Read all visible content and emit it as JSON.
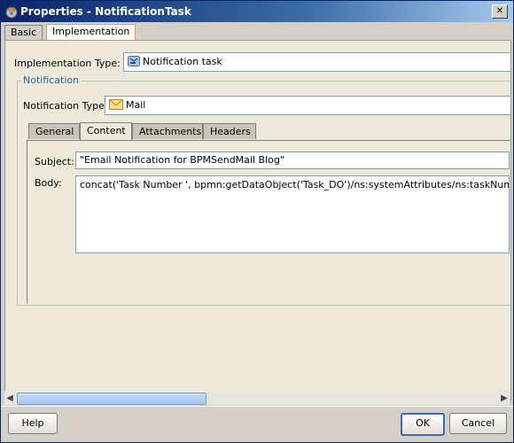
{
  "window": {
    "title": "Properties - NotificationTask",
    "close_glyph": "✕"
  },
  "outer_tabs": [
    {
      "label": "Basic"
    },
    {
      "label": "Implementation"
    }
  ],
  "implementation": {
    "type_label": "Implementation Type:",
    "type_value": "Notification task"
  },
  "notification": {
    "legend": "Notification",
    "type_label": "Notification Type:",
    "type_value": "Mail"
  },
  "inner_tabs": [
    {
      "label": "General"
    },
    {
      "label": "Content"
    },
    {
      "label": "Attachments"
    },
    {
      "label": "Headers"
    }
  ],
  "content": {
    "subject_label": "Subject:",
    "subject_value": "\"Email Notification for BPMSendMail Blog\"",
    "body_label": "Body:",
    "body_value": "concat('Task Number ', bpmn:getDataObject('Task_DO')/ns:systemAttributes/ns:taskNumber, ' has be"
  },
  "buttons": {
    "help": "Help",
    "ok": "OK",
    "cancel": "Cancel"
  },
  "colors": {
    "title_bar": "#0a246a",
    "active_tab_border": "#e6a040",
    "legend_text": "#2f5fa0"
  }
}
